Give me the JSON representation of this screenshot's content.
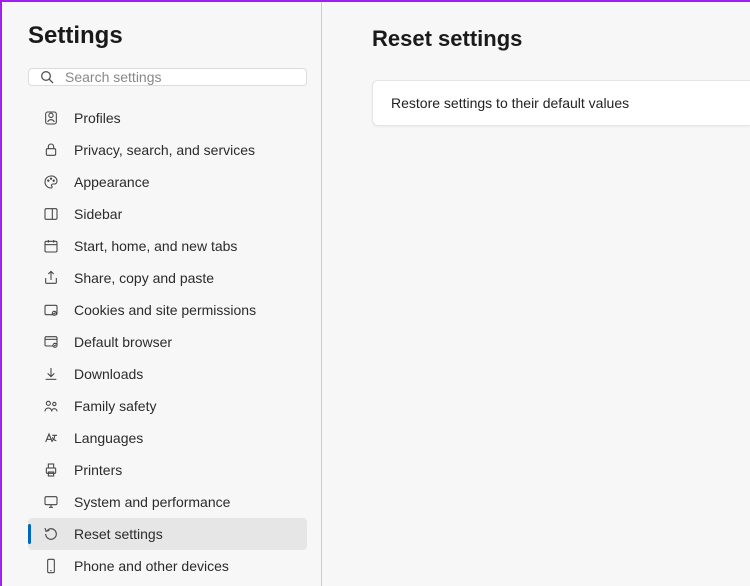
{
  "sidebar": {
    "title": "Settings",
    "search": {
      "placeholder": "Search settings"
    },
    "items": [
      {
        "label": "Profiles",
        "icon": "profiles-icon",
        "selected": false
      },
      {
        "label": "Privacy, search, and services",
        "icon": "lock-icon",
        "selected": false
      },
      {
        "label": "Appearance",
        "icon": "palette-icon",
        "selected": false
      },
      {
        "label": "Sidebar",
        "icon": "sidebar-icon",
        "selected": false
      },
      {
        "label": "Start, home, and new tabs",
        "icon": "calendar-icon",
        "selected": false
      },
      {
        "label": "Share, copy and paste",
        "icon": "share-icon",
        "selected": false
      },
      {
        "label": "Cookies and site permissions",
        "icon": "cookies-icon",
        "selected": false
      },
      {
        "label": "Default browser",
        "icon": "browser-icon",
        "selected": false
      },
      {
        "label": "Downloads",
        "icon": "download-icon",
        "selected": false
      },
      {
        "label": "Family safety",
        "icon": "family-icon",
        "selected": false
      },
      {
        "label": "Languages",
        "icon": "languages-icon",
        "selected": false
      },
      {
        "label": "Printers",
        "icon": "printers-icon",
        "selected": false
      },
      {
        "label": "System and performance",
        "icon": "system-icon",
        "selected": false
      },
      {
        "label": "Reset settings",
        "icon": "reset-icon",
        "selected": true
      },
      {
        "label": "Phone and other devices",
        "icon": "phone-icon",
        "selected": false
      }
    ]
  },
  "main": {
    "title": "Reset settings",
    "card": {
      "label": "Restore settings to their default values"
    }
  },
  "annotation": {
    "arrow_color": "#9b1fe8"
  }
}
